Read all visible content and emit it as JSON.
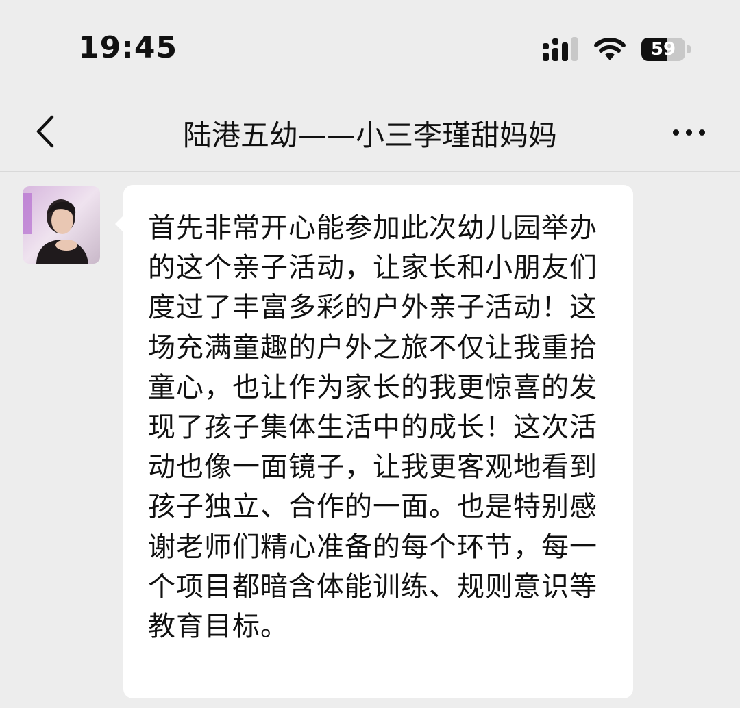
{
  "status_bar": {
    "time": "19:45",
    "battery_level": "59",
    "battery_percent": 59,
    "icons": [
      "signal-icon",
      "wifi-icon",
      "battery-icon"
    ]
  },
  "nav": {
    "back_icon": "chevron-left-icon",
    "title": "陆港五幼——小三李瑾甜妈妈",
    "more_icon": "more-dots-icon"
  },
  "message": {
    "sender_avatar": "avatar",
    "text": "首先非常开心能参加此次幼儿园举办的这个亲子活动，让家长和小朋友们度过了丰富多彩的户外亲子活动！这场充满童趣的户外之旅不仅让我重拾童心，也让作为家长的我更惊喜的发现了孩子集体生活中的成长！这次活动也像一面镜子，让我更客观地看到孩子独立、合作的一面。也是特别感谢老师们精心准备的每个环节，每一个项目都暗含体能训练、规则意识等教育目标。"
  },
  "colors": {
    "background": "#ededed",
    "bubble": "#ffffff",
    "text": "#111111",
    "divider": "#d9d9d9"
  }
}
